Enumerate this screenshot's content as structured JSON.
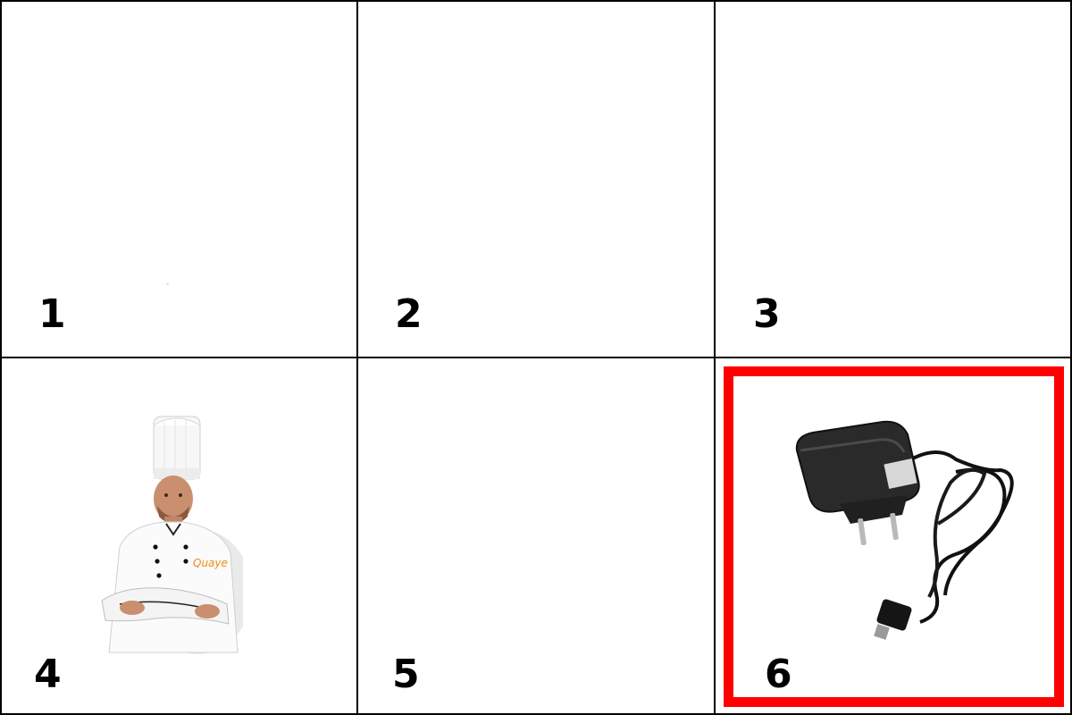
{
  "grid": {
    "cells": [
      {
        "label": "1",
        "content": ""
      },
      {
        "label": "2",
        "content": ""
      },
      {
        "label": "3",
        "content": ""
      },
      {
        "label": "4",
        "content": "chef-image"
      },
      {
        "label": "5",
        "content": ""
      },
      {
        "label": "6",
        "content": "charger-image"
      }
    ],
    "selected_index": 6
  },
  "colors": {
    "border": "#000000",
    "selection": "#ff0000",
    "background": "#ffffff"
  }
}
